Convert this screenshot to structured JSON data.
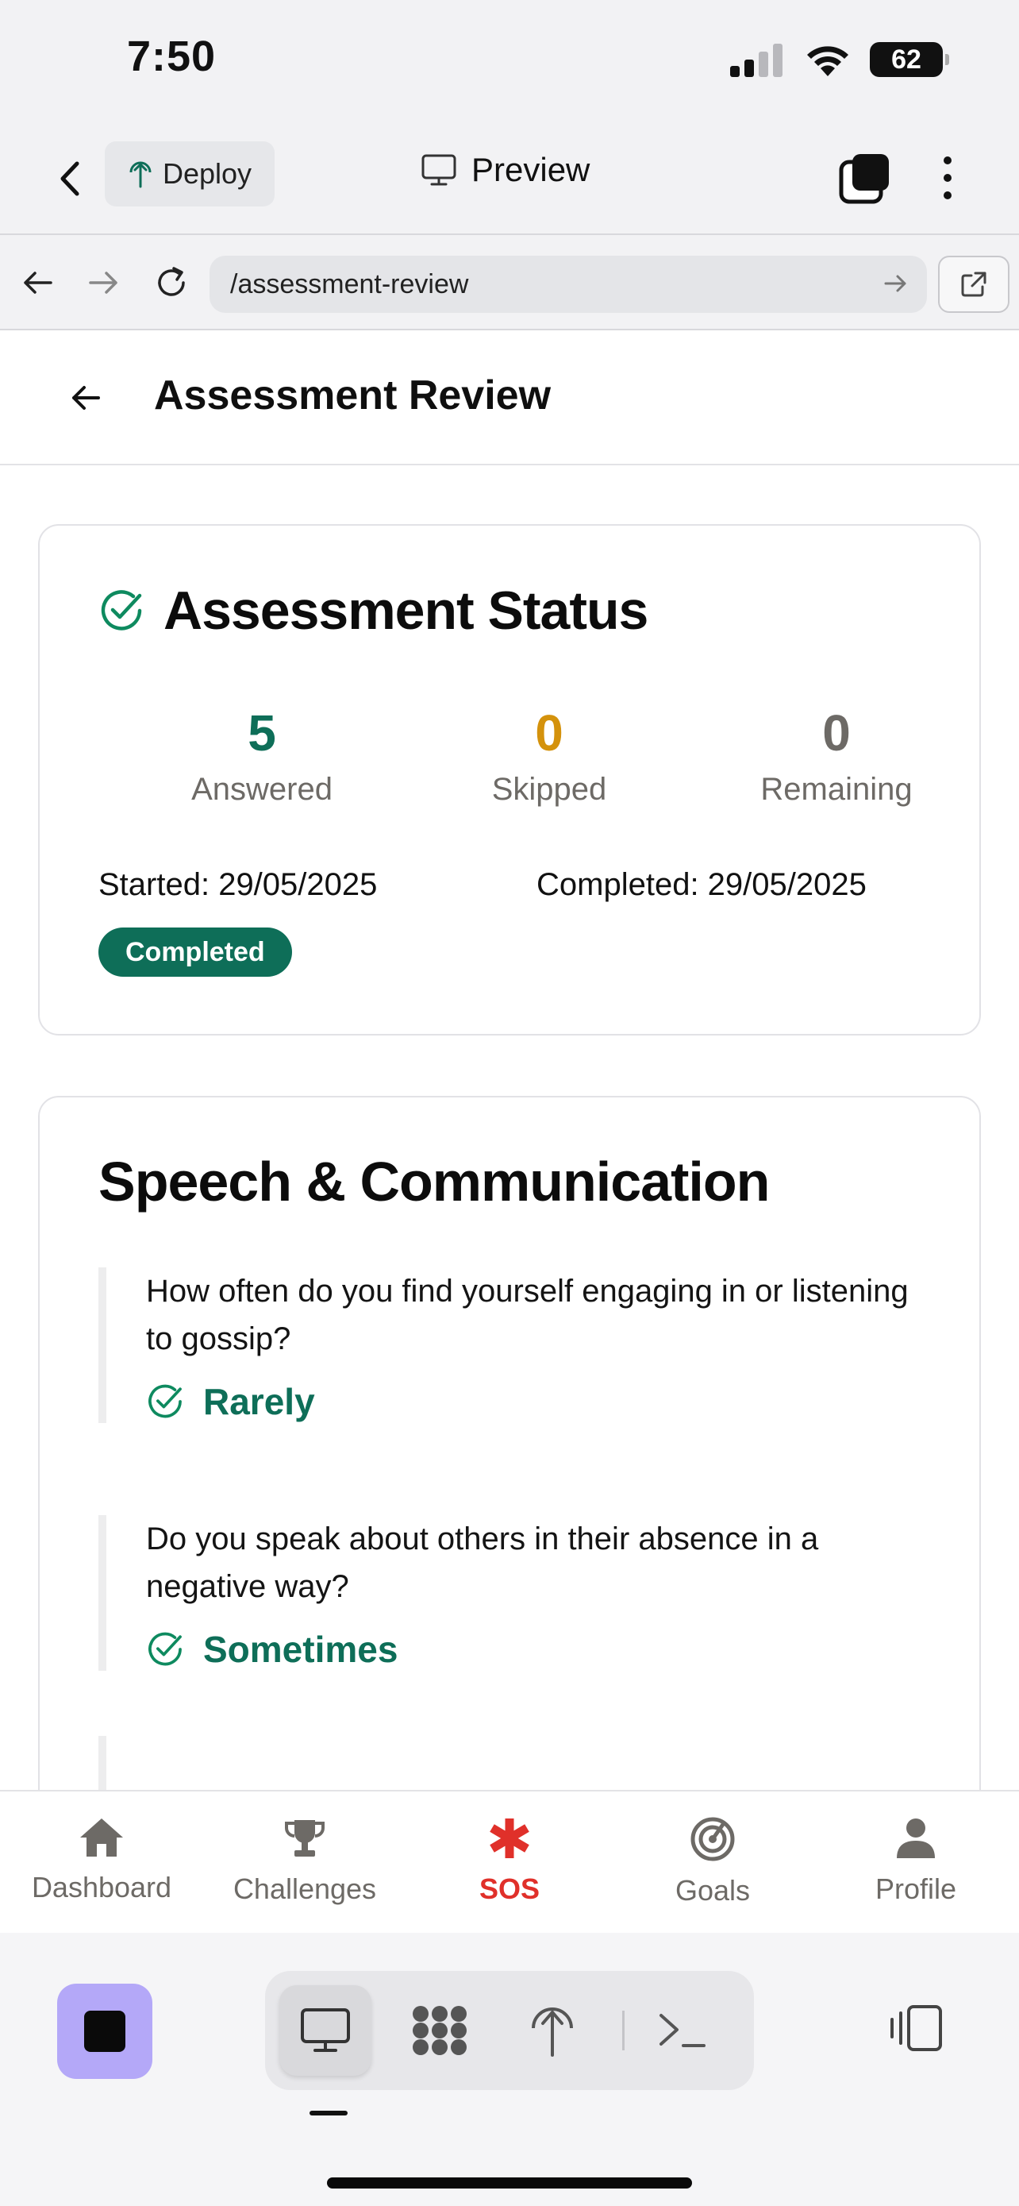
{
  "status_bar": {
    "time": "7:50",
    "battery": "62"
  },
  "toolbar": {
    "deploy_label": "Deploy",
    "preview_label": "Preview"
  },
  "address_bar": {
    "url": "/assessment-review"
  },
  "header": {
    "title": "Assessment Review"
  },
  "status_card": {
    "title": "Assessment Status",
    "stats": [
      {
        "value": "5",
        "label": "Answered",
        "color": "#0e6e58"
      },
      {
        "value": "0",
        "label": "Skipped",
        "color": "#d4920c"
      },
      {
        "value": "0",
        "label": "Remaining",
        "color": "#6d6a66"
      }
    ],
    "started": "Started: 29/05/2025",
    "completed": "Completed: 29/05/2025",
    "badge": "Completed"
  },
  "speech_card": {
    "title": "Speech & Communication",
    "questions": [
      {
        "question": "How often do you find yourself engaging in or listening to gossip?",
        "answer": "Rarely"
      },
      {
        "question": "Do you speak about others in their absence in a negative way?",
        "answer": "Sometimes"
      }
    ]
  },
  "bottom_nav": {
    "items": [
      {
        "label": "Dashboard",
        "icon": "home-icon"
      },
      {
        "label": "Challenges",
        "icon": "trophy-icon"
      },
      {
        "label": "SOS",
        "icon": "asterisk-icon"
      },
      {
        "label": "Goals",
        "icon": "target-icon"
      },
      {
        "label": "Profile",
        "icon": "person-icon"
      }
    ],
    "active_index": 2
  },
  "editor_bar": {
    "tools": [
      "monitor-icon",
      "grid-icon",
      "deploy-icon",
      "terminal-icon"
    ],
    "active_tool": 0
  },
  "colors": {
    "accent": "#0e6e58",
    "sos": "#e0302a",
    "stop_button": "#b4a8f8"
  }
}
